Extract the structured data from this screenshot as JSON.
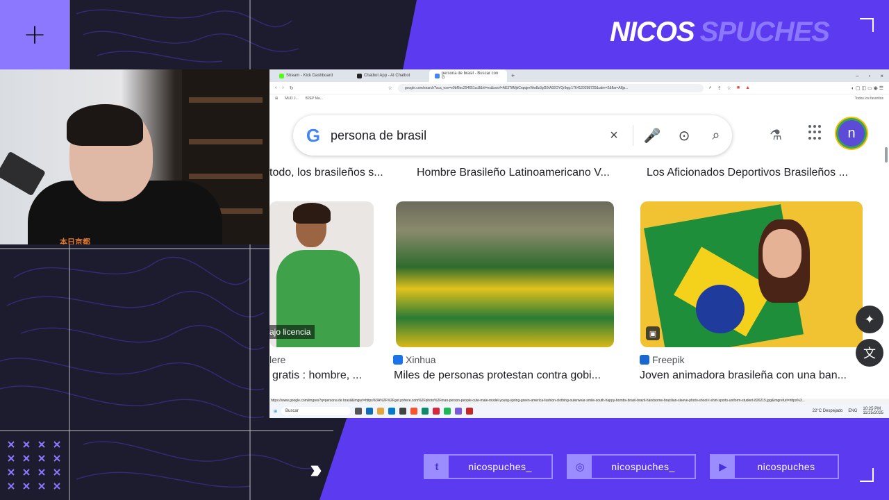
{
  "overlay": {
    "brand_first": "NICOS",
    "brand_second": "SPUCHES",
    "plus_symbol": "+",
    "arrows": "›››",
    "colors": {
      "purple": "#5b3af0",
      "lavender": "#8b78ff",
      "dark": "#1d1c2e"
    },
    "socials": [
      {
        "icon": "twitter-icon",
        "glyph": "t",
        "handle": "nicospuches_"
      },
      {
        "icon": "instagram-icon",
        "glyph": "◎",
        "handle": "nicospuches_"
      },
      {
        "icon": "youtube-icon",
        "glyph": "▶",
        "handle": "nicospuches"
      }
    ]
  },
  "webcam": {
    "shirt_text": "本日京都"
  },
  "browser": {
    "tabs": [
      {
        "label": "Stream - Kick Dashboard",
        "color": "#53fc18"
      },
      {
        "label": "Chatbot App - AI Chatbot",
        "color": "#222"
      },
      {
        "label": "persona de brasil - Buscar con G",
        "color": "#4285f4"
      }
    ],
    "new_tab": "+",
    "window_controls": [
      "–",
      "▫",
      "×"
    ],
    "url": "google.com/search?sca_esv=e0bf6ec294651cc8&hl=es&sxsrf=AE3TifMjkCnpqjmWw8z3gGlXA92OYQr9qg:1764120298725&udm=2&fbs=AIIjp...",
    "bookmarks": [
      "MUD J...",
      "B2EP Ma..."
    ],
    "bookmarks_right": "Todos los favoritos",
    "search": {
      "logo": "G",
      "query": "persona de brasil",
      "clear_icon": "×",
      "mic_icon": "🎤",
      "lens_icon": "⊙",
      "search_icon": "⌕"
    },
    "avatar_letter": "n",
    "captions": [
      "todo, los brasileños s...",
      "Hombre Brasileño Latinoamericano V...",
      "Los Aficionados Deportivos Brasileños ..."
    ],
    "licence_label": "ajo licencia",
    "results": [
      {
        "source": "lere",
        "title": "gratis : hombre, ...",
        "src_color": ""
      },
      {
        "source": "Xinhua",
        "title": "Miles de personas protestan contra gobi...",
        "src_color": "#1a73e8"
      },
      {
        "source": "Freepik",
        "title": "Joven animadora brasileña con una ban...",
        "src_color": "#1967d2"
      }
    ],
    "status_url": "https://www.google.com/imgres?q=persona de brasil&imgurl=https%3A%2F%2Fget.pxhere.com%2Fphoto%2Fman-person-people-cute-male-model-young-spring-green-america-fashion-clothing-outerwear-smile-south-happy-bombs-brasil-brazil-handsome-brazilian-sleeve-photo-shoot-t-shirt-sports-uniform-student-826215.jpg&imgrefurl=https%3...",
    "taskbar": {
      "search_placeholder": "Buscar",
      "weather": "22°C  Despejado",
      "lang": "ENG",
      "time": "10:25 PM",
      "date": "11/25/2025"
    }
  }
}
